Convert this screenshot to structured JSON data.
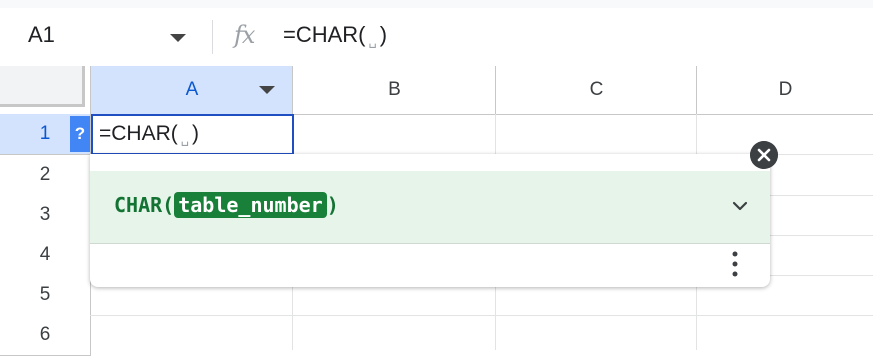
{
  "formula_bar": {
    "name_box": "A1",
    "fx_label": "fx",
    "formula_prefix": "=CHAR(",
    "space_glyph": "␣",
    "formula_suffix": ")"
  },
  "columns": [
    "A",
    "B",
    "C",
    "D"
  ],
  "rows": [
    "1",
    "2",
    "3",
    "4",
    "5",
    "6"
  ],
  "active_cell": {
    "help_label": "?",
    "prefix": "=CHAR(",
    "space_glyph": "␣",
    "suffix": ")"
  },
  "formula_help": {
    "function_name": "CHAR(",
    "argument": "table_number",
    "close_paren": ")"
  },
  "colors": {
    "selection_blue": "#1f4fc2",
    "header_highlight": "#d3e3fd",
    "popup_green_bg": "#e6f4ea",
    "function_green": "#137333",
    "argument_bg": "#188038"
  }
}
